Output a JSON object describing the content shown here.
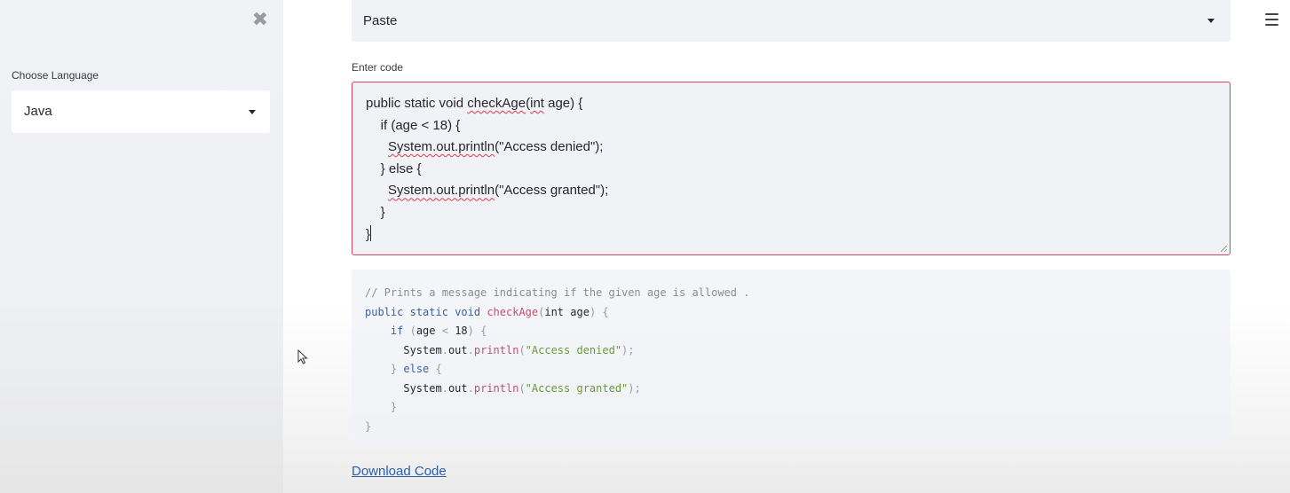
{
  "sidebar": {
    "close_icon": "close-icon",
    "language_label": "Choose Language",
    "language_value": "Java"
  },
  "main": {
    "mode_value": "Paste",
    "menu_icon": "hamburger-menu-icon",
    "editor": {
      "label": "Enter code",
      "border_color": "#d2465d",
      "lines": [
        [
          "public static void ",
          {
            "t": "checkAge",
            "sq": true
          },
          "(",
          {
            "t": "int",
            "sq": true
          },
          " age) {"
        ],
        [
          "    if (age < 18) {"
        ],
        [
          "      ",
          {
            "t": "System.out.println",
            "sq": true
          },
          "(\"Access denied\");"
        ],
        [
          "    } else {"
        ],
        [
          "      ",
          {
            "t": "System.out.println",
            "sq": true
          },
          "(\"Access granted\");"
        ],
        [
          "    }"
        ],
        [
          "}"
        ]
      ]
    },
    "code_block": {
      "lines": [
        [
          [
            "comment",
            "// Prints a message indicating if the given age is allowed ."
          ]
        ],
        [
          [
            "kw",
            "public"
          ],
          [
            "plain",
            " "
          ],
          [
            "kw",
            "static"
          ],
          [
            "plain",
            " "
          ],
          [
            "kw",
            "void"
          ],
          [
            "plain",
            " "
          ],
          [
            "fn",
            "checkAge"
          ],
          [
            "punc",
            "("
          ],
          [
            "plain",
            "int age"
          ],
          [
            "punc",
            ")"
          ],
          [
            "plain",
            " "
          ],
          [
            "punc",
            "{"
          ]
        ],
        [
          [
            "plain",
            "    "
          ],
          [
            "kw",
            "if"
          ],
          [
            "plain",
            " "
          ],
          [
            "punc",
            "("
          ],
          [
            "plain",
            "age "
          ],
          [
            "punc",
            "<"
          ],
          [
            "plain",
            " 18"
          ],
          [
            "punc",
            ")"
          ],
          [
            "plain",
            " "
          ],
          [
            "punc",
            "{"
          ]
        ],
        [
          [
            "plain",
            "      System"
          ],
          [
            "punc",
            "."
          ],
          [
            "plain",
            "out"
          ],
          [
            "punc",
            "."
          ],
          [
            "fn",
            "println"
          ],
          [
            "punc",
            "("
          ],
          [
            "str",
            "\"Access denied\""
          ],
          [
            "punc",
            ");"
          ]
        ],
        [
          [
            "plain",
            "    "
          ],
          [
            "punc",
            "}"
          ],
          [
            "plain",
            " "
          ],
          [
            "kw",
            "else"
          ],
          [
            "plain",
            " "
          ],
          [
            "punc",
            "{"
          ]
        ],
        [
          [
            "plain",
            "      System"
          ],
          [
            "punc",
            "."
          ],
          [
            "plain",
            "out"
          ],
          [
            "punc",
            "."
          ],
          [
            "fn",
            "println"
          ],
          [
            "punc",
            "("
          ],
          [
            "str",
            "\"Access granted\""
          ],
          [
            "punc",
            ");"
          ]
        ],
        [
          [
            "plain",
            "    "
          ],
          [
            "punc",
            "}"
          ]
        ],
        [
          [
            "punc",
            "}"
          ]
        ]
      ]
    },
    "download_label": "Download Code"
  },
  "colors": {
    "sidebar_bg": "#f0f2f6",
    "editor_border": "#d2465d",
    "link": "#2d5fa8",
    "keyword": "#3a5fa8",
    "function": "#c2506b",
    "string": "#6b9a3c"
  }
}
